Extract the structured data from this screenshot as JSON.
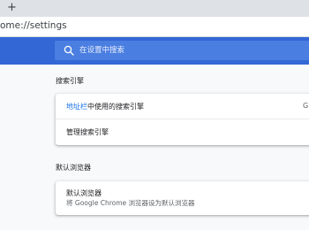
{
  "browser": {
    "new_tab_symbol": "+",
    "url_text": "ome://settings"
  },
  "search": {
    "placeholder": "在设置中搜索",
    "icon": "search-icon"
  },
  "sections": {
    "search_engine": {
      "title": "搜索引擎",
      "row1_link": "地址栏",
      "row1_rest": "中使用的搜索引擎",
      "row1_value": "G",
      "row2_label": "管理搜索引擎"
    },
    "default_browser": {
      "title": "默认浏览器",
      "row_label": "默认浏览器",
      "row_sub": "将 Google Chrome 浏览器设为默认浏览器"
    }
  },
  "colors": {
    "accent": "#3367d6",
    "link": "#1a73e8",
    "background": "#f8f9fa"
  }
}
